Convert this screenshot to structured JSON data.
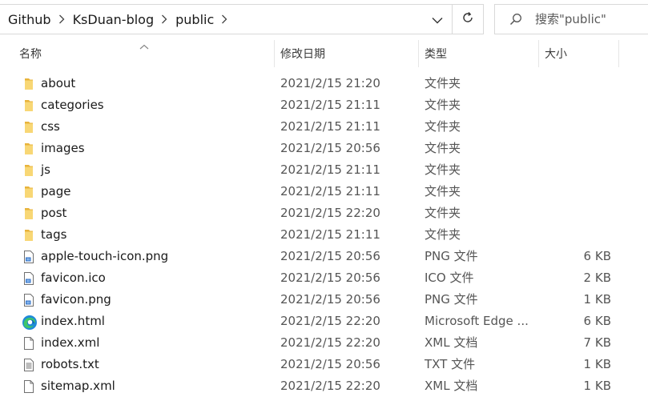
{
  "breadcrumb": [
    "Github",
    "KsDuan-blog",
    "public"
  ],
  "search": {
    "placeholder": "搜索\"public\""
  },
  "columns": {
    "name": "名称",
    "date": "修改日期",
    "type": "类型",
    "size": "大小"
  },
  "colors": {
    "folder": "#f5c542",
    "border": "#d9d9d9",
    "text_secondary": "#555555"
  },
  "files": [
    {
      "name": "about",
      "date": "2021/2/15 21:20",
      "type": "文件夹",
      "size": "",
      "icon": "folder-icon"
    },
    {
      "name": "categories",
      "date": "2021/2/15 21:11",
      "type": "文件夹",
      "size": "",
      "icon": "folder-icon"
    },
    {
      "name": "css",
      "date": "2021/2/15 21:11",
      "type": "文件夹",
      "size": "",
      "icon": "folder-icon"
    },
    {
      "name": "images",
      "date": "2021/2/15 20:56",
      "type": "文件夹",
      "size": "",
      "icon": "folder-icon"
    },
    {
      "name": "js",
      "date": "2021/2/15 21:11",
      "type": "文件夹",
      "size": "",
      "icon": "folder-icon"
    },
    {
      "name": "page",
      "date": "2021/2/15 21:11",
      "type": "文件夹",
      "size": "",
      "icon": "folder-icon"
    },
    {
      "name": "post",
      "date": "2021/2/15 22:20",
      "type": "文件夹",
      "size": "",
      "icon": "folder-icon"
    },
    {
      "name": "tags",
      "date": "2021/2/15 21:11",
      "type": "文件夹",
      "size": "",
      "icon": "folder-icon"
    },
    {
      "name": "apple-touch-icon.png",
      "date": "2021/2/15 20:56",
      "type": "PNG 文件",
      "size": "6 KB",
      "icon": "image-file-icon"
    },
    {
      "name": "favicon.ico",
      "date": "2021/2/15 20:56",
      "type": "ICO 文件",
      "size": "2 KB",
      "icon": "image-file-icon"
    },
    {
      "name": "favicon.png",
      "date": "2021/2/15 20:56",
      "type": "PNG 文件",
      "size": "1 KB",
      "icon": "image-file-icon"
    },
    {
      "name": "index.html",
      "date": "2021/2/15 22:20",
      "type": "Microsoft Edge ...",
      "size": "6 KB",
      "icon": "edge-icon"
    },
    {
      "name": "index.xml",
      "date": "2021/2/15 22:20",
      "type": "XML 文档",
      "size": "7 KB",
      "icon": "blank-file-icon"
    },
    {
      "name": "robots.txt",
      "date": "2021/2/15 20:56",
      "type": "TXT 文件",
      "size": "1 KB",
      "icon": "text-file-icon"
    },
    {
      "name": "sitemap.xml",
      "date": "2021/2/15 22:20",
      "type": "XML 文档",
      "size": "1 KB",
      "icon": "blank-file-icon"
    }
  ]
}
